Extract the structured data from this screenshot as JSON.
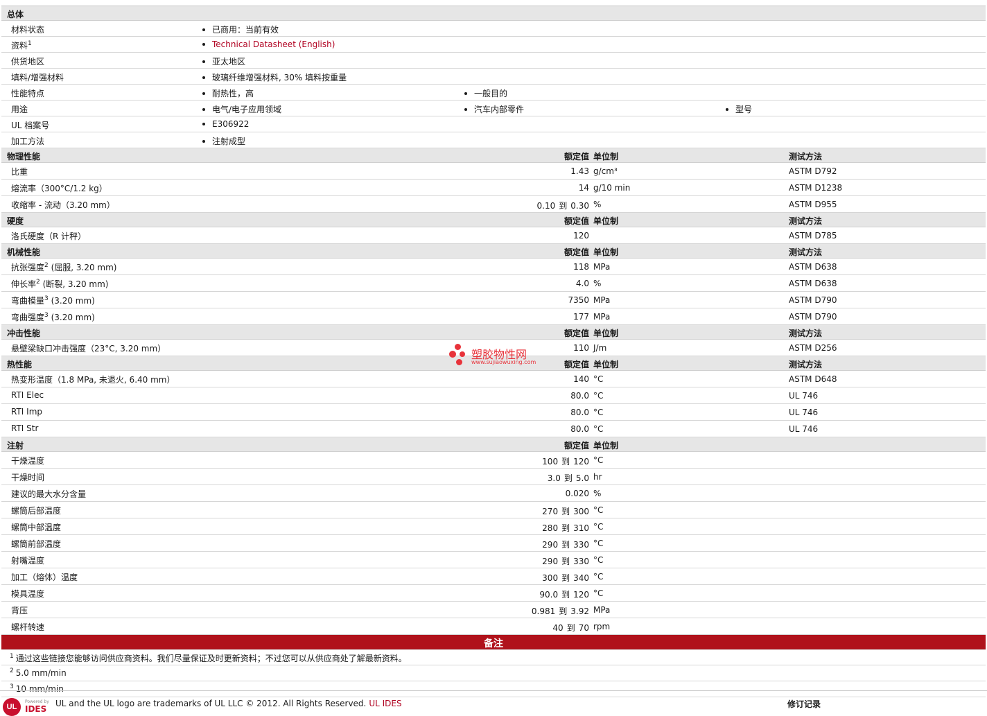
{
  "general": {
    "title": "总体",
    "rows": [
      {
        "label": "材料状态",
        "items": [
          "已商用：当前有效"
        ]
      },
      {
        "label": "资料",
        "sup": "1",
        "items": [
          "Technical Datasheet (English)"
        ],
        "link": true
      },
      {
        "label": "供货地区",
        "items": [
          "亚太地区"
        ]
      },
      {
        "label": "填料/增强材料",
        "items": [
          "玻璃纤维增强材料, 30% 填料按重量"
        ]
      },
      {
        "label": "性能特点",
        "items": [
          "耐热性，高",
          "一般目的"
        ]
      },
      {
        "label": "用途",
        "items": [
          "电气/电子应用领域",
          "汽车内部零件",
          "型号"
        ]
      },
      {
        "label": "UL 档案号",
        "items": [
          "E306922"
        ]
      },
      {
        "label": "加工方法",
        "items": [
          "注射成型"
        ]
      }
    ]
  },
  "headers": {
    "nominal": "额定值",
    "unit": "单位制",
    "test": "测试方法"
  },
  "sections": [
    {
      "title": "物理性能",
      "show_test": true,
      "rows": [
        {
          "label": "比重",
          "value": "1.43",
          "unit": "g/cm³",
          "test": "ASTM D792"
        },
        {
          "label": "熔流率（300°C/1.2 kg）",
          "value": "14",
          "unit": "g/10 min",
          "test": "ASTM D1238"
        },
        {
          "label": "收缩率 - 流动（3.20 mm）",
          "from": "0.10",
          "to_word": "到",
          "value": "0.30",
          "unit": "%",
          "test": "ASTM D955"
        }
      ]
    },
    {
      "title": "硬度",
      "show_test": true,
      "rows": [
        {
          "label": "洛氏硬度（R 计秤）",
          "value": "120",
          "unit": "",
          "test": "ASTM D785"
        }
      ]
    },
    {
      "title": "机械性能",
      "show_test": true,
      "rows": [
        {
          "label": "抗张强度",
          "sup": "2",
          "suffix": " (屈服, 3.20 mm)",
          "value": "118",
          "unit": "MPa",
          "test": "ASTM D638"
        },
        {
          "label": "伸长率",
          "sup": "2",
          "suffix": " (断裂, 3.20 mm)",
          "value": "4.0",
          "unit": "%",
          "test": "ASTM D638"
        },
        {
          "label": "弯曲模量",
          "sup": "3",
          "suffix": " (3.20 mm)",
          "value": "7350",
          "unit": "MPa",
          "test": "ASTM D790"
        },
        {
          "label": "弯曲强度",
          "sup": "3",
          "suffix": " (3.20 mm)",
          "value": "177",
          "unit": "MPa",
          "test": "ASTM D790"
        }
      ]
    },
    {
      "title": "冲击性能",
      "show_test": true,
      "rows": [
        {
          "label": "悬壁梁缺口冲击强度（23°C, 3.20 mm）",
          "value": "110",
          "unit": "J/m",
          "test": "ASTM D256"
        }
      ]
    },
    {
      "title": "热性能",
      "show_test": true,
      "rows": [
        {
          "label": "热变形温度（1.8 MPa, 未退火, 6.40 mm）",
          "value": "140",
          "unit": "°C",
          "test": "ASTM D648"
        },
        {
          "label": "RTI Elec",
          "value": "80.0",
          "unit": "°C",
          "test": "UL 746"
        },
        {
          "label": "RTI Imp",
          "value": "80.0",
          "unit": "°C",
          "test": "UL 746"
        },
        {
          "label": "RTI Str",
          "value": "80.0",
          "unit": "°C",
          "test": "UL 746"
        }
      ]
    },
    {
      "title": "注射",
      "show_test": false,
      "rows": [
        {
          "label": "干燥温度",
          "from": "100",
          "to_word": "到",
          "value": "120",
          "unit": "°C"
        },
        {
          "label": "干燥时间",
          "from": "3.0",
          "to_word": "到",
          "value": "5.0",
          "unit": "hr"
        },
        {
          "label": "建议的最大水分含量",
          "value": "0.020",
          "unit": "%"
        },
        {
          "label": "螺筒后部温度",
          "from": "270",
          "to_word": "到",
          "value": "300",
          "unit": "°C"
        },
        {
          "label": "螺筒中部温度",
          "from": "280",
          "to_word": "到",
          "value": "310",
          "unit": "°C"
        },
        {
          "label": "螺筒前部温度",
          "from": "290",
          "to_word": "到",
          "value": "330",
          "unit": "°C"
        },
        {
          "label": "射嘴温度",
          "from": "290",
          "to_word": "到",
          "value": "330",
          "unit": "°C"
        },
        {
          "label": "加工（熔体）温度",
          "from": "300",
          "to_word": "到",
          "value": "340",
          "unit": "°C"
        },
        {
          "label": "模具温度",
          "from": "90.0",
          "to_word": "到",
          "value": "120",
          "unit": "°C"
        },
        {
          "label": "背压",
          "from": "0.981",
          "to_word": "到",
          "value": "3.92",
          "unit": "MPa"
        },
        {
          "label": "螺杆转速",
          "from": "40",
          "to_word": "到",
          "value": "70",
          "unit": "rpm"
        }
      ]
    }
  ],
  "notes": {
    "title": "备注",
    "items": [
      {
        "sup": "1",
        "text": "通过这些链接您能够访问供应商资料。我们尽量保证及时更新资料；不过您可以从供应商处了解最新资料。"
      },
      {
        "sup": "2",
        "text": "5.0 mm/min"
      },
      {
        "sup": "3",
        "text": "10 mm/min"
      }
    ]
  },
  "footer": {
    "logo_text": "UL",
    "powered_by": "Powered by",
    "ides": "IDES",
    "trademark": "UL and the UL logo are trademarks of UL LLC © 2012. All Rights Reserved.",
    "ul_ides_link": "UL IDES",
    "revision_title": "修订记录"
  },
  "watermark": {
    "title": "塑胶物性网",
    "url": "www.sujiaowuxing.com"
  },
  "colors": {
    "accent_red": "#b0121b",
    "link_red": "#b00020",
    "header_gray": "#e6e6e6"
  }
}
